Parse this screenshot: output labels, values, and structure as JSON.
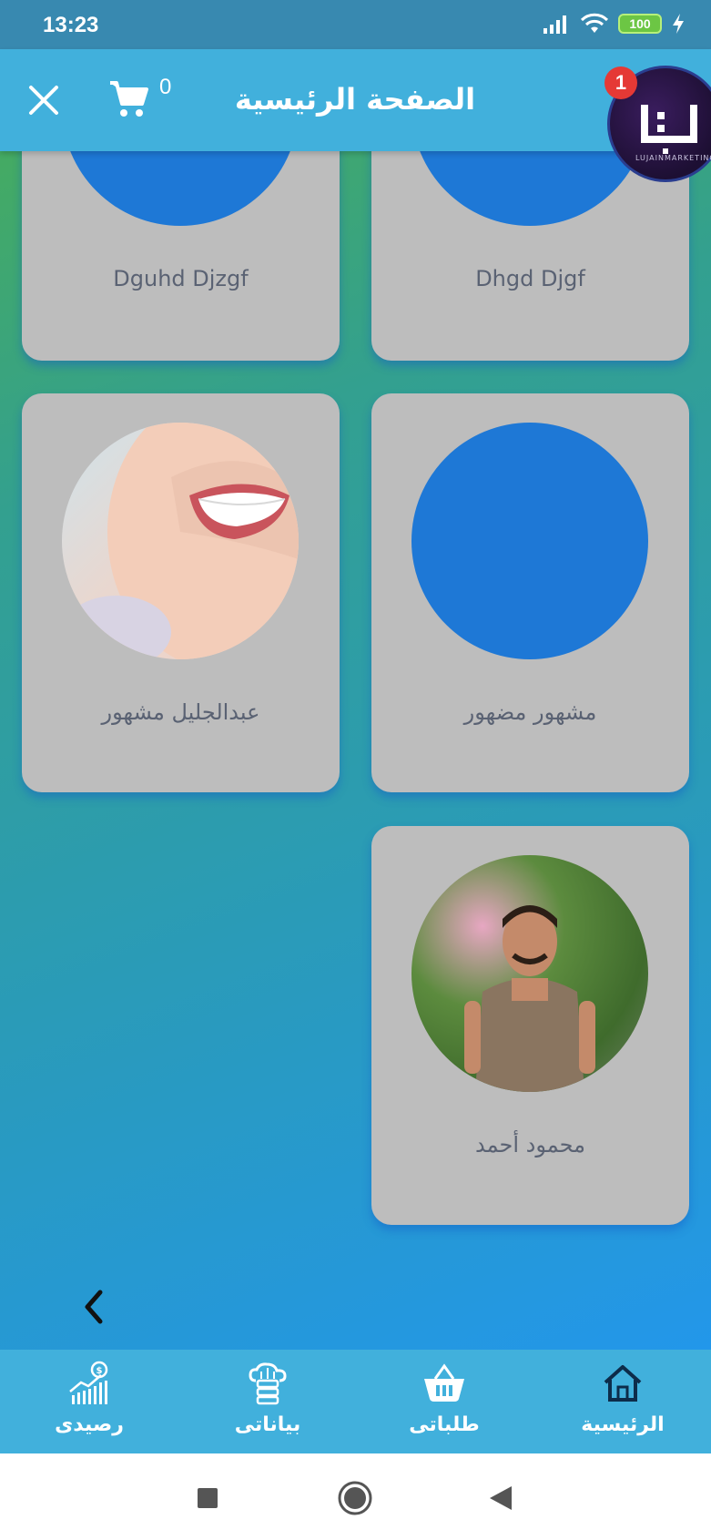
{
  "status_bar": {
    "time": "13:23",
    "battery": "100",
    "icons": [
      "signal-icon",
      "wifi-icon",
      "battery-icon",
      "charging-icon"
    ]
  },
  "app_bar": {
    "title": "الصفحة الرئيسية",
    "cart_count": "0",
    "logo_badge": "1",
    "logo_text": "LUJAINMARKETING"
  },
  "cards": [
    {
      "name": "Dhgd Djgf",
      "avatar": "solid"
    },
    {
      "name": "Dguhd Djzgf",
      "avatar": "solid"
    },
    {
      "name": "مشهور مضهور",
      "avatar": "solid"
    },
    {
      "name": "عبدالجليل مشهور",
      "avatar": "photo-smile"
    },
    {
      "name": "محمود أحمد",
      "avatar": "photo-person"
    }
  ],
  "bottom_nav": {
    "items": [
      {
        "label": "الرئيسية",
        "icon": "home-icon"
      },
      {
        "label": "طلباتى",
        "icon": "basket-icon"
      },
      {
        "label": "بياناتى",
        "icon": "cloud-data-icon"
      },
      {
        "label": "رصيدى",
        "icon": "balance-chart-icon"
      }
    ]
  },
  "colors": {
    "app_bar": "#41b0dc",
    "status_bar": "#3889b0",
    "card": "#bdbdbd",
    "avatar_placeholder": "#1e78d6",
    "badge": "#e53935"
  }
}
